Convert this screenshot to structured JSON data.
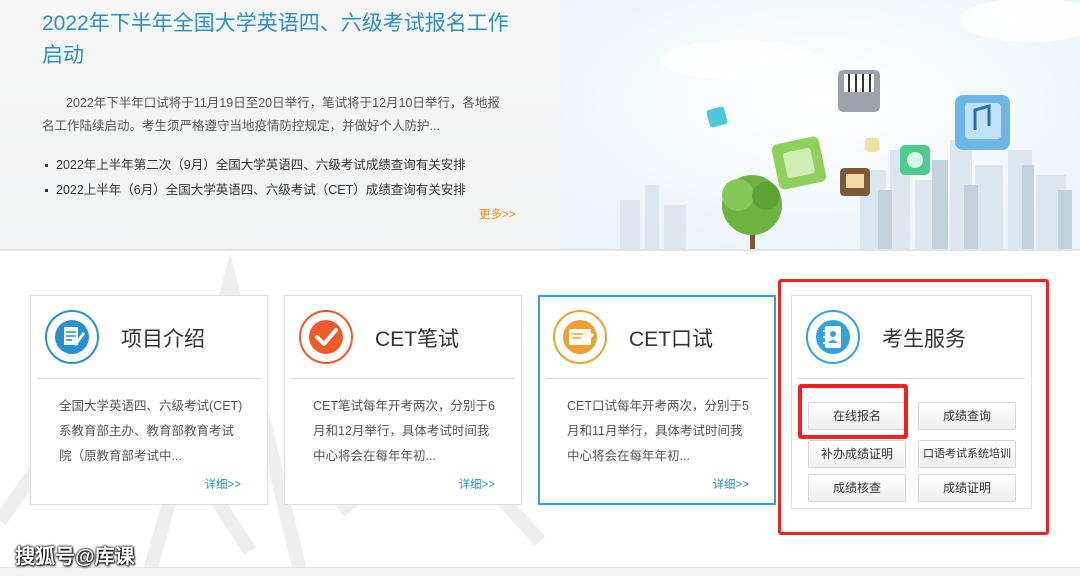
{
  "news": {
    "title": "2022年下半年全国大学英语四、六级考试报名工作启动",
    "summary": "2022年下半年口试将于11月19日至20日举行，笔试将于12月10日举行，各地报名工作陆续启动。考生须严格遵守当地疫情防控规定，并做好个人防护...",
    "items": [
      "2022年上半年第二次（9月）全国大学英语四、六级考试成绩查询有关安排",
      "2022上半年（6月）全国大学英语四、六级考试（CET）成绩查询有关安排"
    ],
    "more": "更多>>"
  },
  "cards": [
    {
      "title": "项目介绍",
      "desc": "全国大学英语四、六级考试(CET)系教育部主办、教育部教育考试院（原教育部考试中...",
      "more": "详细>>",
      "icon": "document-edit-icon",
      "color": "#2a8fd0"
    },
    {
      "title": "CET笔试",
      "desc": "CET笔试每年开考两次，分别于6月和12月举行，具体考试时间我中心将会在每年年初...",
      "more": "详细>>",
      "icon": "checkmark-icon",
      "color": "#ee5a2a"
    },
    {
      "title": "CET口试",
      "desc": "CET口试每年开考两次，分别于5月和11月举行，具体考试时间我中心将会在每年年初...",
      "more": "详细>>",
      "icon": "certificate-icon",
      "color": "#f0a030"
    }
  ],
  "service": {
    "title": "考生服务",
    "icon": "address-book-icon",
    "color": "#31a3dc",
    "buttons": [
      "在线报名",
      "成绩查询",
      "补办成绩证明",
      "口语考试系统培训",
      "成绩核查",
      "成绩证明"
    ]
  },
  "watermark": "搜狐号@库课"
}
